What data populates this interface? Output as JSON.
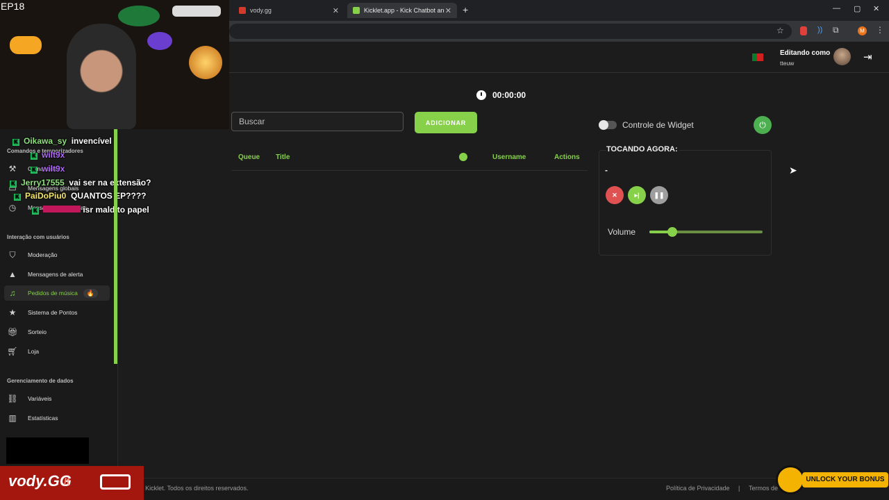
{
  "stream": {
    "episode": "EP18"
  },
  "browser": {
    "tabs": [
      {
        "title": "vody.gg",
        "active": false
      },
      {
        "title": "Kicklet.app - Kick Chatbot and",
        "active": true
      }
    ]
  },
  "header": {
    "editing_label": "Editando como",
    "username": "tteuw"
  },
  "sidebar": {
    "section_commands": "Comandos e temporizadores",
    "commands_items": [
      {
        "label": "Comandos",
        "icon": "hammer-icon"
      },
      {
        "label": "Mensagens globais",
        "icon": "chat-icon"
      },
      {
        "label": "Mensagens periódicas",
        "icon": "clock-icon"
      }
    ],
    "section_interaction": "Interação com usuários",
    "interaction_items": [
      {
        "label": "Moderação",
        "icon": "shield-icon"
      },
      {
        "label": "Mensagens de alerta",
        "icon": "warning-icon"
      },
      {
        "label": "Pedidos de música",
        "icon": "music-icon",
        "badge": "🔥",
        "active": true
      },
      {
        "label": "Sistema de Pontos",
        "icon": "star-icon"
      },
      {
        "label": "Sorteio",
        "icon": "gift-icon"
      },
      {
        "label": "Loja",
        "icon": "cart-icon"
      }
    ],
    "section_data": "Gerenciamento de dados",
    "data_items": [
      {
        "label": "Variáveis",
        "icon": "link-icon"
      },
      {
        "label": "Estatísticas",
        "icon": "chart-icon"
      }
    ]
  },
  "main": {
    "timer": "00:00:00",
    "search_placeholder": "Buscar",
    "add_button": "ADICIONAR",
    "queue_columns": {
      "queue": "Queue",
      "title": "Title",
      "username": "Username",
      "actions": "Actions"
    }
  },
  "widget": {
    "toggle_label": "Controle de Widget",
    "now_playing_label": "TOCANDO AGORA:",
    "now_playing_title": "-",
    "volume_label": "Volume",
    "volume_level": 0.2
  },
  "footer": {
    "copyright": "© Kicklet. Todos os direitos reservados.",
    "privacy": "Política de Privacidade",
    "separator": "|",
    "terms": "Termos de"
  },
  "chat": [
    {
      "user": "Oikawa_sy",
      "message": "invencível",
      "color": "#8ee07c"
    },
    {
      "user": "wilt9x",
      "message": "",
      "color": "#b266ff"
    },
    {
      "user": "wilt9x",
      "message": "",
      "color": "#b266ff"
    },
    {
      "user": "Jerry17555",
      "message": "vai ser na extensão?",
      "color": "#8ee07c"
    },
    {
      "user": "PaiDoPiu0",
      "message": "QUANTOS EP????",
      "color": "#f5e663"
    },
    {
      "user": "",
      "message": "isr maldito papel",
      "color": "#ff4d6d"
    }
  ],
  "overlay": {
    "vody_brand": "vody.GG",
    "vody_suffix": "/t",
    "bonus_text": "UNLOCK YOUR BONUS"
  },
  "colors": {
    "accent": "#86d04a",
    "background": "#1c1c1c",
    "sidebar": "#1a1a1a"
  }
}
